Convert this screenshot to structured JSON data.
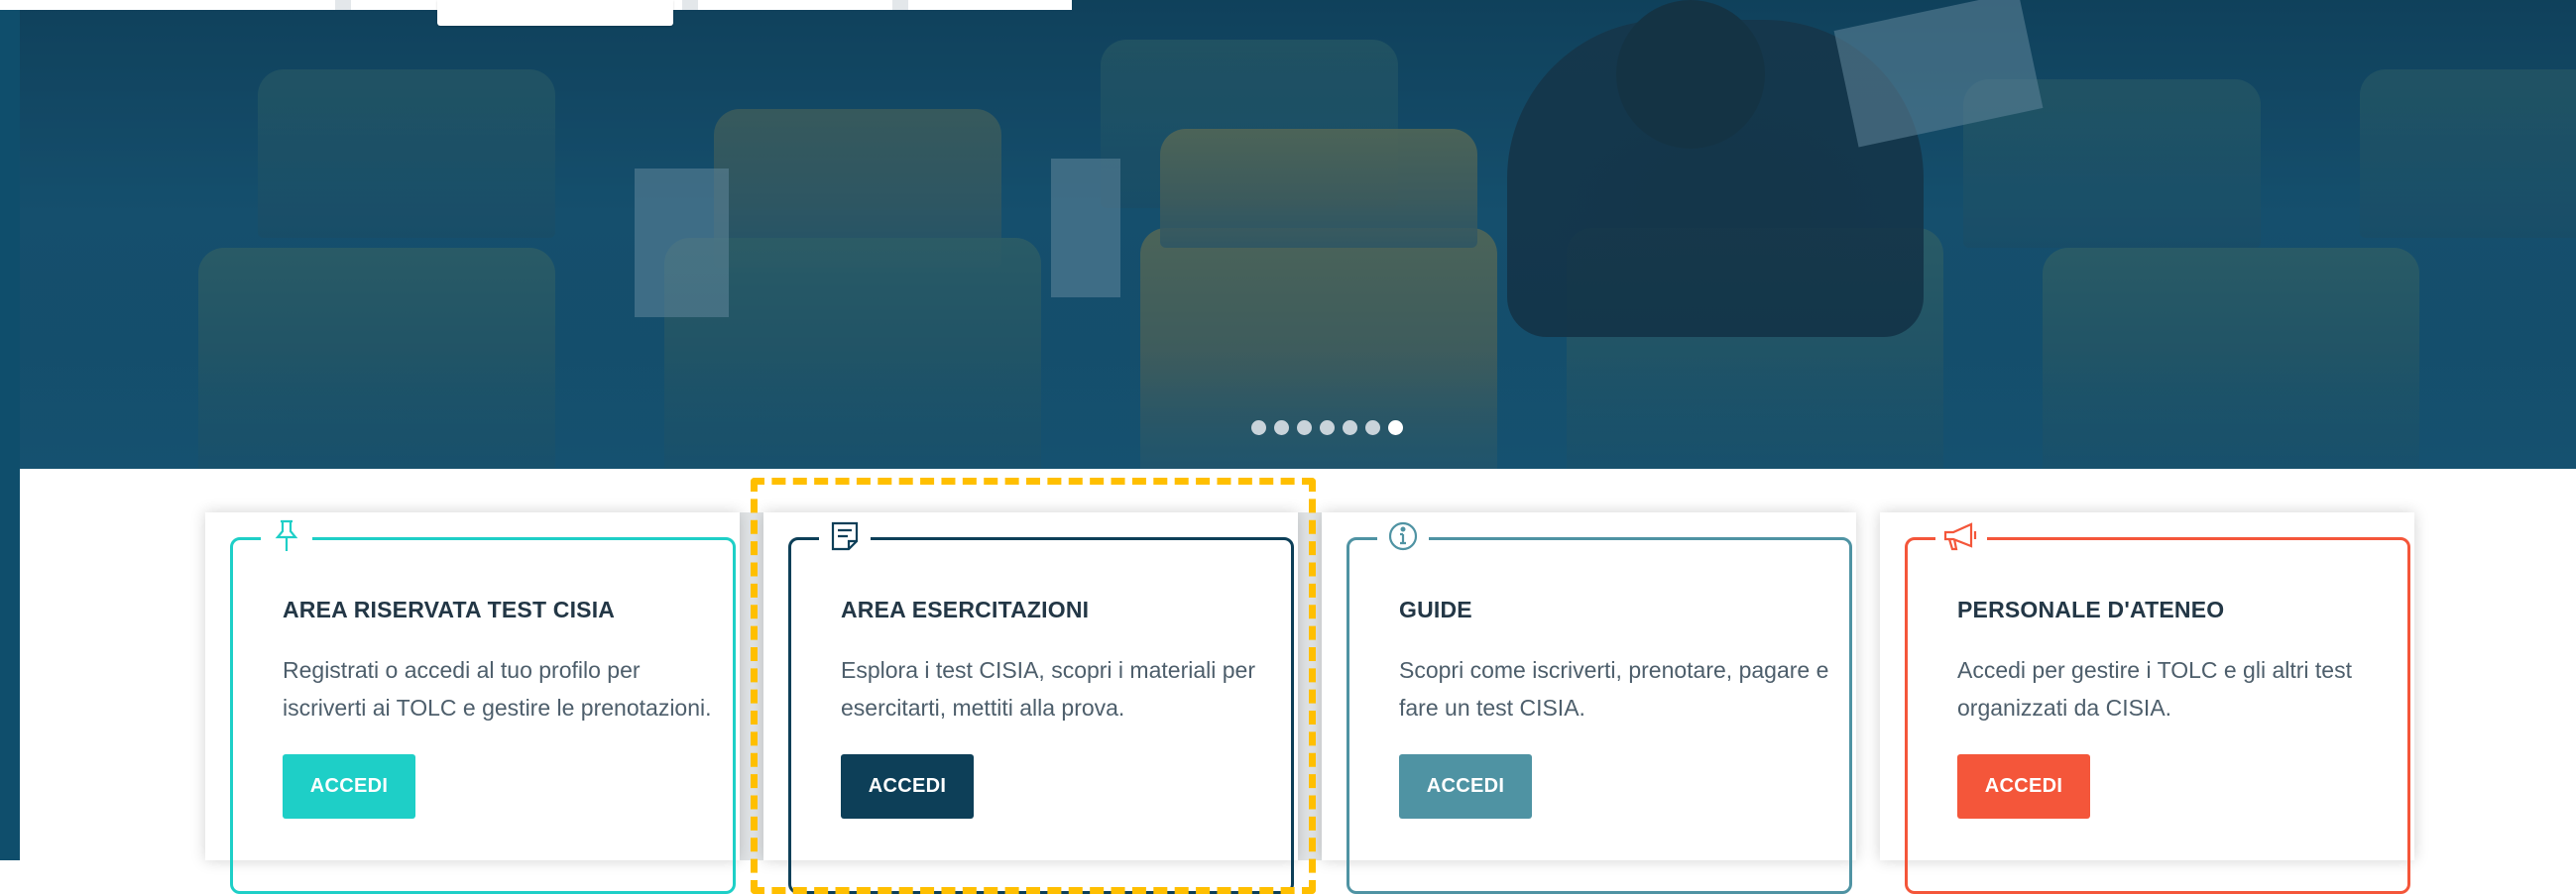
{
  "colors": {
    "teal": "#1ecfc7",
    "navy": "#0d3f58",
    "steel": "#4f93a3",
    "coral": "#f4563a",
    "highlight": "#ffbf00"
  },
  "hero": {
    "slide_count": 7,
    "active_slide": 7
  },
  "cards": [
    {
      "icon": "pushpin-icon",
      "title": "AREA RISERVATA TEST CISIA",
      "text": "Registrati o accedi al tuo profilo per iscriverti ai TOLC e gestire le prenotazioni.",
      "button": "ACCEDI"
    },
    {
      "icon": "note-icon",
      "title": "AREA ESERCITAZIONI",
      "text": "Esplora i test CISIA, scopri i materiali per esercitarti, mettiti alla prova.",
      "button": "ACCEDI"
    },
    {
      "icon": "info-icon",
      "title": "GUIDE",
      "text": "Scopri come iscriverti, prenotare, pagare e fare un test CISIA.",
      "button": "ACCEDI"
    },
    {
      "icon": "megaphone-icon",
      "title": "PERSONALE D'ATENEO",
      "text": "Accedi per gestire i TOLC e gli altri test organizzati da CISIA.",
      "button": "ACCEDI"
    }
  ]
}
